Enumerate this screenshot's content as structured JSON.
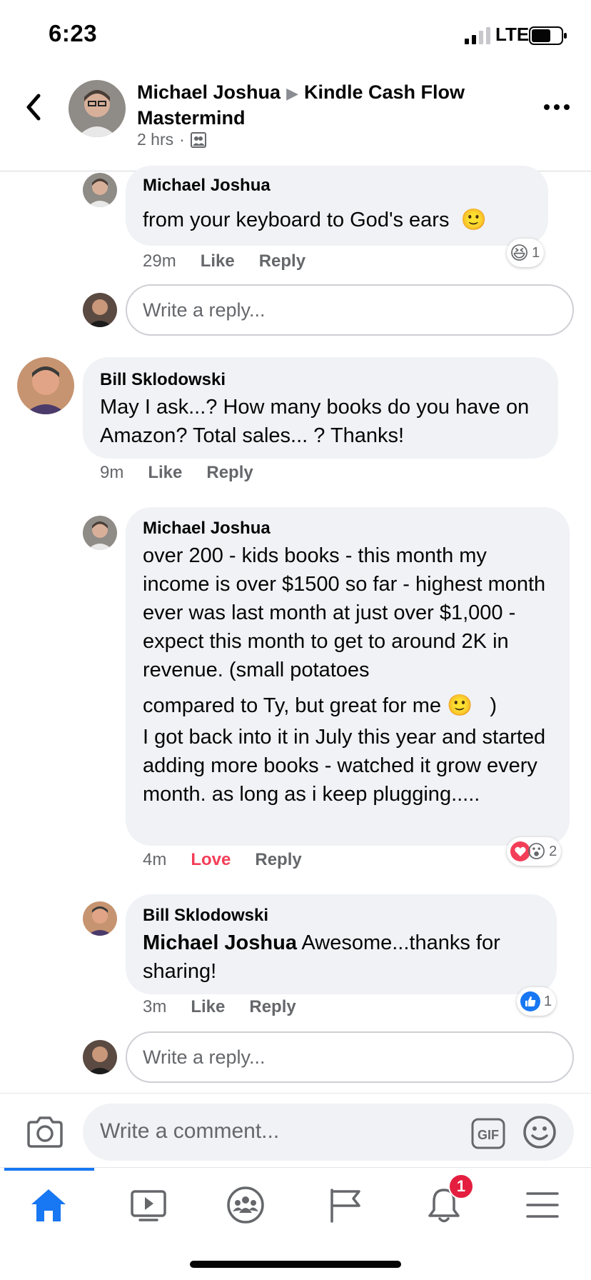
{
  "status_bar": {
    "time": "6:23",
    "network": "LTE"
  },
  "header": {
    "author": "Michael Joshua",
    "group": "Kindle Cash Flow Mastermind",
    "time": "2 hrs",
    "separator": "·"
  },
  "comments": [
    {
      "author": "Michael Joshua",
      "text": "from your keyboard to God's ears",
      "emoji": "🙂",
      "time": "29m",
      "action1": "Like",
      "action2": "Reply",
      "reaction_count": "1"
    },
    {
      "author": "Bill Sklodowski",
      "text": "May I ask...? How many books do you have on Amazon? Total sales... ? Thanks!",
      "time": "9m",
      "action1": "Like",
      "action2": "Reply"
    },
    {
      "author": "Michael Joshua",
      "text_part1": "over 200 - kids books - this month my income is over $1500 so far - highest month ever was last month at just over $1,000 - expect this month to get to around 2K in revenue. (small potatoes",
      "text_part2": "compared to Ty, but great for me",
      "emoji": "🙂",
      "text_part2_end": ")",
      "text_part3": "I got back into it in July this year and started adding more books - watched it grow every month. as long as i keep plugging.....",
      "time": "4m",
      "action1": "Love",
      "action2": "Reply",
      "reaction_count": "2"
    },
    {
      "author": "Bill Sklodowski",
      "mention": "Michael Joshua",
      "text": " Awesome...thanks for sharing!",
      "time": "3m",
      "action1": "Like",
      "action2": "Reply",
      "reaction_count": "1"
    }
  ],
  "reply_placeholder": "Write a reply...",
  "comment_placeholder": "Write a comment...",
  "gif_label": "GIF",
  "notification_count": "1",
  "colors": {
    "accent": "#1877f2",
    "love": "#f33e58",
    "badge": "#e41e3f",
    "bubble": "#f0f2f5"
  },
  "icons": [
    "back-icon",
    "more-icon",
    "group-icon",
    "camera-icon",
    "gif-icon",
    "emoji-icon",
    "home-icon",
    "watch-icon",
    "groups-icon",
    "pages-icon",
    "bell-icon",
    "menu-icon"
  ]
}
